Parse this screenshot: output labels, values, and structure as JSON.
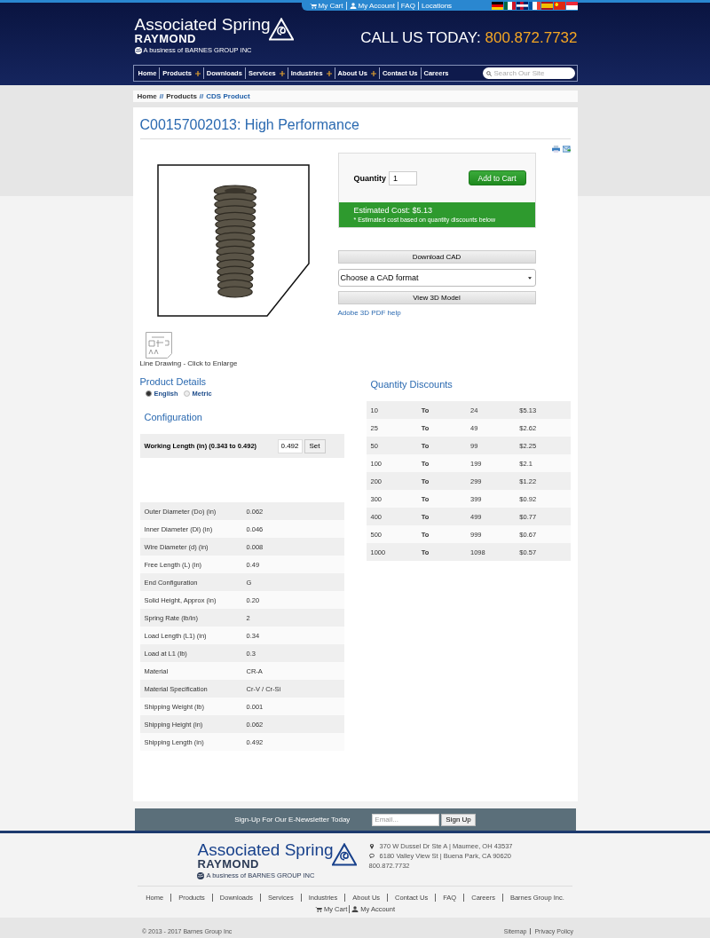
{
  "top_links": {
    "cart": "My Cart",
    "account": "My Account",
    "faq": "FAQ",
    "locations": "Locations"
  },
  "logo": {
    "name": "Associated Spring",
    "sub": "RAYMOND",
    "tagline": "A business of BARNES GROUP INC"
  },
  "call": {
    "label": "CALL US TODAY:",
    "phone": "800.872.7732"
  },
  "nav": [
    {
      "label": "Home",
      "submenu": false
    },
    {
      "label": "Products",
      "submenu": true
    },
    {
      "label": "Downloads",
      "submenu": false
    },
    {
      "label": "Services",
      "submenu": true
    },
    {
      "label": "Industries",
      "submenu": true
    },
    {
      "label": "About Us",
      "submenu": true
    },
    {
      "label": "Contact Us",
      "submenu": false
    },
    {
      "label": "Careers",
      "submenu": false
    }
  ],
  "search": {
    "placeholder": "Search Our Site"
  },
  "breadcrumb": {
    "separator": "//",
    "items": [
      {
        "label": "Home",
        "current": false
      },
      {
        "label": "Products",
        "current": false
      },
      {
        "label": "CDS Product",
        "current": true
      }
    ]
  },
  "title": "C00157002013: High Performance",
  "order": {
    "quantity_label": "Quantity",
    "quantity": "1",
    "add_button": "Add to Cart",
    "estimate": "Estimated Cost: $5.13",
    "estimate_note": "* Estimated cost based on quantity discounts below",
    "download_button": "Download CAD",
    "cad_select": "Choose a CAD format",
    "view_button": "View 3D Model",
    "help_link": "Adobe 3D PDF help"
  },
  "line_drawing_caption": "Line Drawing - Click to Enlarge",
  "details": {
    "heading": "Product Details",
    "units": [
      {
        "label": "English",
        "selected": true
      },
      {
        "label": "Metric",
        "selected": false
      }
    ],
    "config_heading": "Configuration",
    "config": {
      "label": "Working Length (in) (0.343 to 0.492)",
      "value": "0.492",
      "button": "Set"
    },
    "rows": [
      {
        "name": "Outer Diameter (Do) (in)",
        "value": "0.062"
      },
      {
        "name": "Inner Diameter (Di) (in)",
        "value": "0.046"
      },
      {
        "name": "Wire Diameter (d) (in)",
        "value": "0.008"
      },
      {
        "name": "Free Length (L) (in)",
        "value": "0.49"
      },
      {
        "name": "End Configuration",
        "value": "G"
      },
      {
        "name": "Solid Height, Approx (in)",
        "value": "0.20"
      },
      {
        "name": "Spring Rate (lb/in)",
        "value": "2"
      },
      {
        "name": "Load Length (L1) (in)",
        "value": "0.34"
      },
      {
        "name": "Load at L1 (lb)",
        "value": "0.3"
      },
      {
        "name": "Material",
        "value": "CR-A"
      },
      {
        "name": "Material Specification",
        "value": "Cr-V / Cr-Si"
      },
      {
        "name": "Shipping Weight (lb)",
        "value": "0.001"
      },
      {
        "name": "Shipping Height (in)",
        "value": "0.062"
      },
      {
        "name": "Shipping Length (in)",
        "value": "0.492"
      }
    ]
  },
  "discounts": {
    "heading": "Quantity Discounts",
    "rows": [
      {
        "from": "10",
        "to_label": "To",
        "to": "24",
        "price": "$5.13"
      },
      {
        "from": "25",
        "to_label": "To",
        "to": "49",
        "price": "$2.62"
      },
      {
        "from": "50",
        "to_label": "To",
        "to": "99",
        "price": "$2.25"
      },
      {
        "from": "100",
        "to_label": "To",
        "to": "199",
        "price": "$2.1"
      },
      {
        "from": "200",
        "to_label": "To",
        "to": "299",
        "price": "$1.22"
      },
      {
        "from": "300",
        "to_label": "To",
        "to": "399",
        "price": "$0.92"
      },
      {
        "from": "400",
        "to_label": "To",
        "to": "499",
        "price": "$0.77"
      },
      {
        "from": "500",
        "to_label": "To",
        "to": "999",
        "price": "$0.67"
      },
      {
        "from": "1000",
        "to_label": "To",
        "to": "1098",
        "price": "$0.57"
      }
    ]
  },
  "newsletter": {
    "text": "Sign-Up For Our E-Newsletter Today",
    "placeholder": "Email...",
    "button": "Sign Up"
  },
  "footer": {
    "logo": {
      "name": "Associated Spring",
      "sub": "RAYMOND",
      "tagline": "A business of BARNES GROUP INC"
    },
    "address1": "370 W Dussel Dr Ste A | Maumee, OH 43537",
    "address2": "6180 Valley View St | Buena Park, CA 90620",
    "phone": "800.872.7732",
    "links": [
      "Home",
      "Products",
      "Downloads",
      "Services",
      "Industries",
      "About Us",
      "Contact Us",
      "FAQ",
      "Careers",
      "Barnes Group Inc."
    ],
    "cart": "My Cart",
    "account": "My Account",
    "copyright": "© 2013 - 2017 Barnes Group Inc",
    "bottom_links": [
      "Sitemap",
      "Privacy Policy"
    ]
  }
}
